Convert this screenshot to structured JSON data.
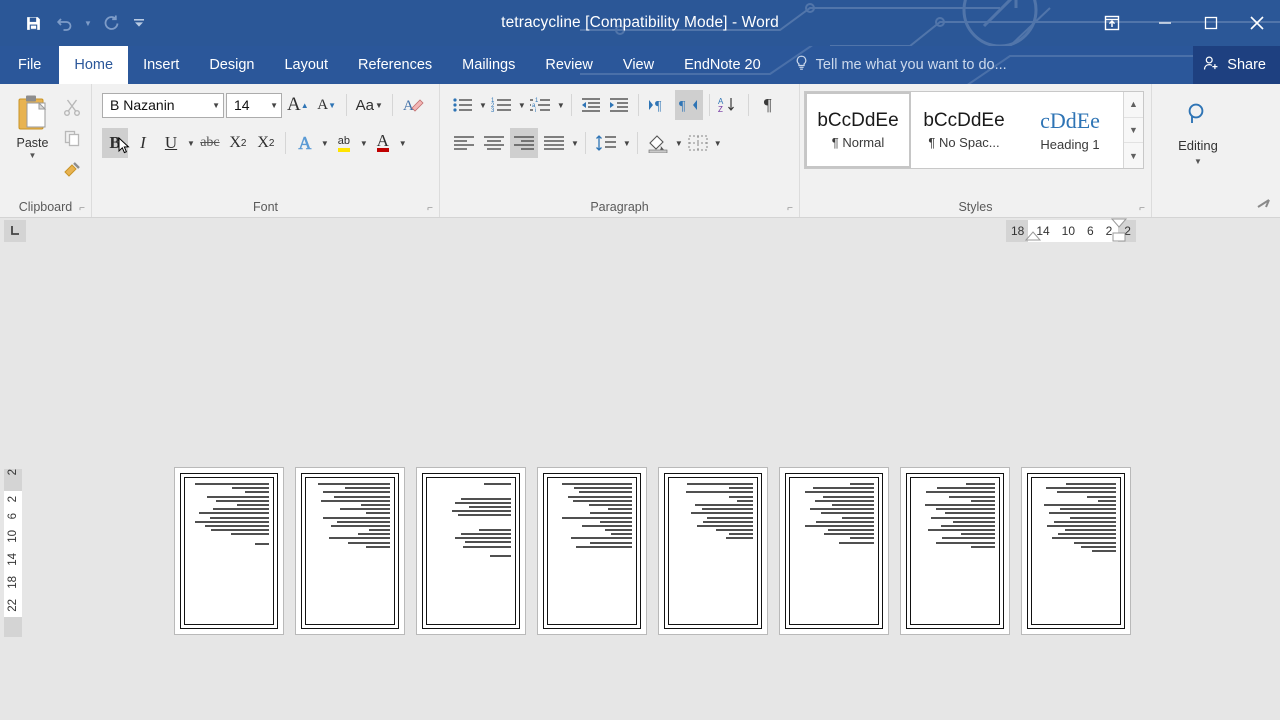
{
  "window": {
    "title": "tetracycline [Compatibility Mode] - Word",
    "quick_access": [
      {
        "name": "save",
        "icon": "save-icon",
        "enabled": true
      },
      {
        "name": "undo",
        "icon": "undo-icon",
        "enabled": false
      },
      {
        "name": "redo",
        "icon": "redo-icon",
        "enabled": false
      },
      {
        "name": "customize",
        "icon": "chevron-down-icon",
        "enabled": true
      }
    ],
    "controls": {
      "ribbon_display": "ribbon-display-options-icon",
      "minimize": "minimize-icon",
      "maximize": "maximize-icon",
      "close": "close-icon"
    }
  },
  "tabs": [
    {
      "label": "File",
      "active": false
    },
    {
      "label": "Home",
      "active": true
    },
    {
      "label": "Insert",
      "active": false
    },
    {
      "label": "Design",
      "active": false
    },
    {
      "label": "Layout",
      "active": false
    },
    {
      "label": "References",
      "active": false
    },
    {
      "label": "Mailings",
      "active": false
    },
    {
      "label": "Review",
      "active": false
    },
    {
      "label": "View",
      "active": false
    },
    {
      "label": "EndNote 20",
      "active": false
    }
  ],
  "tellme": {
    "placeholder": "Tell me what you want to do...",
    "icon": "lightbulb-icon"
  },
  "share": {
    "label": "Share",
    "icon": "person-add-icon"
  },
  "ribbon": {
    "clipboard": {
      "label": "Clipboard",
      "paste_label": "Paste",
      "buttons": [
        "cut-icon",
        "copy-icon",
        "format-painter-icon"
      ]
    },
    "font": {
      "label": "Font",
      "font_name": "B Nazanin",
      "font_size": "14",
      "grow_font": "A",
      "shrink_font": "A",
      "change_case": "Aa",
      "clear_formatting": "clear-formatting-icon",
      "bold": "B",
      "italic": "I",
      "underline": "U",
      "strikethrough": "abc",
      "subscript": "X",
      "superscript": "X",
      "text_effects": "A",
      "highlight": "ab",
      "font_color": "A",
      "bold_active": true
    },
    "paragraph": {
      "label": "Paragraph",
      "bullets": "bullets-icon",
      "numbering": "numbering-icon",
      "multilevel": "multilevel-list-icon",
      "decrease_indent": "decrease-indent-icon",
      "increase_indent": "increase-indent-icon",
      "ltr": "left-to-right-icon",
      "rtl": "right-to-left-icon",
      "sort": "sort-icon",
      "show_marks": "show-formatting-marks-icon",
      "align_left": "align-left-icon",
      "align_center": "align-center-icon",
      "align_right": "align-right-icon",
      "justify": "justify-icon",
      "line_spacing": "line-spacing-icon",
      "shading": "shading-icon",
      "borders": "borders-icon",
      "rtl_active": true,
      "align_right_active": true
    },
    "styles": {
      "label": "Styles",
      "items": [
        {
          "preview": "bCcDdEe",
          "name": "¶ Normal",
          "selected": true
        },
        {
          "preview": "bCcDdEe",
          "name": "¶ No Spac...",
          "selected": false
        },
        {
          "preview": "cDdEe",
          "name": "Heading 1",
          "selected": false
        }
      ]
    },
    "editing": {
      "label": "Editing",
      "icon": "search-icon"
    },
    "collapse": "collapse-ribbon-icon"
  },
  "ruler": {
    "tab_stop_icon": "left-tab-stop-icon",
    "horizontal_numbers": [
      "18",
      "14",
      "10",
      "6",
      "2",
      "2"
    ],
    "vertical_numbers": [
      "2",
      "2",
      "6",
      "10",
      "14",
      "18",
      "22"
    ]
  },
  "document": {
    "page_count": 8,
    "view": "multiple-pages",
    "language": "rtl-persian",
    "pages": [
      {
        "lines": [
          92,
          46,
          30,
          78,
          66,
          40,
          70,
          88,
          74,
          92,
          80,
          72,
          48,
          0,
          18
        ]
      },
      {
        "lines": [
          90,
          56,
          84,
          70,
          86,
          36,
          62,
          30,
          84,
          66,
          74,
          26,
          40,
          76,
          52,
          30
        ]
      },
      {
        "lines": [
          34,
          0,
          0,
          62,
          70,
          52,
          74,
          66,
          0,
          0,
          40,
          62,
          70,
          58,
          60,
          0,
          26
        ]
      },
      {
        "lines": [
          88,
          72,
          66,
          80,
          74,
          54,
          30,
          52,
          88,
          40,
          62,
          34,
          26,
          76,
          52,
          70
        ]
      },
      {
        "lines": [
          82,
          30,
          84,
          30,
          20,
          72,
          64,
          78,
          58,
          62,
          70,
          46,
          30,
          34,
          0,
          0
        ]
      },
      {
        "lines": [
          30,
          76,
          86,
          64,
          74,
          52,
          80,
          66,
          40,
          72,
          86,
          58,
          62,
          30,
          44,
          0
        ]
      },
      {
        "lines": [
          36,
          72,
          86,
          58,
          30,
          88,
          74,
          62,
          80,
          52,
          68,
          84,
          42,
          66,
          74,
          30
        ]
      },
      {
        "lines": [
          62,
          88,
          74,
          36,
          22,
          90,
          70,
          84,
          58,
          78,
          86,
          64,
          72,
          80,
          52,
          44,
          30
        ]
      }
    ]
  }
}
